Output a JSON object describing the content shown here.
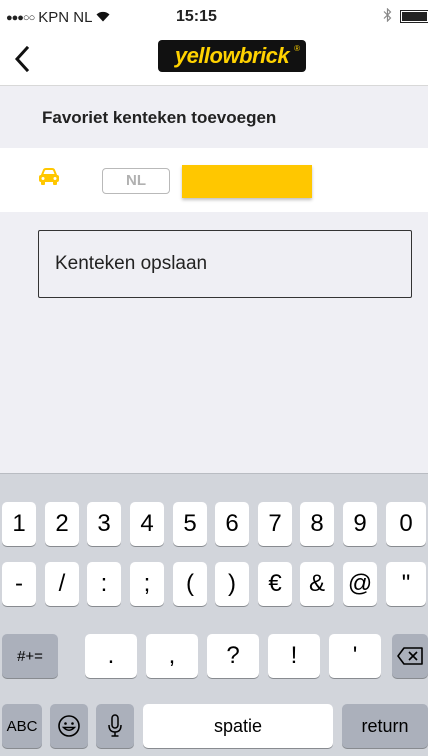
{
  "status_bar": {
    "carrier": "KPN NL",
    "signal": "●●●○○",
    "wifi_icon": "wifi-icon",
    "time": "15:15",
    "bluetooth_icon": "bluetooth-icon",
    "battery_icon": "battery-icon"
  },
  "nav": {
    "back_label": "‹",
    "logo_text": "yellowbrick",
    "logo_reg": "®"
  },
  "section": {
    "title": "Favoriet kenteken toevoegen"
  },
  "plate": {
    "icon": "car-icon",
    "country": "NL",
    "value": ""
  },
  "save_button": {
    "label": "Kenteken opslaan"
  },
  "keyboard": {
    "row1": [
      "1",
      "2",
      "3",
      "4",
      "5",
      "6",
      "7",
      "8",
      "9",
      "0"
    ],
    "row2": [
      "-",
      "/",
      ":",
      ";",
      "(",
      ")",
      "€",
      "&",
      "@",
      "\""
    ],
    "row3": {
      "toggle": "#+=",
      "keys": [
        ".",
        ",",
        "?",
        "!",
        "'"
      ],
      "delete_icon": "delete-icon"
    },
    "row4": {
      "abc": "ABC",
      "emoji_icon": "emoji-icon",
      "mic_icon": "microphone-icon",
      "space": "spatie",
      "return": "return"
    }
  },
  "colors": {
    "brand_yellow": "#ffc700",
    "brand_black": "#111111",
    "car_icon": "#ffc700"
  }
}
